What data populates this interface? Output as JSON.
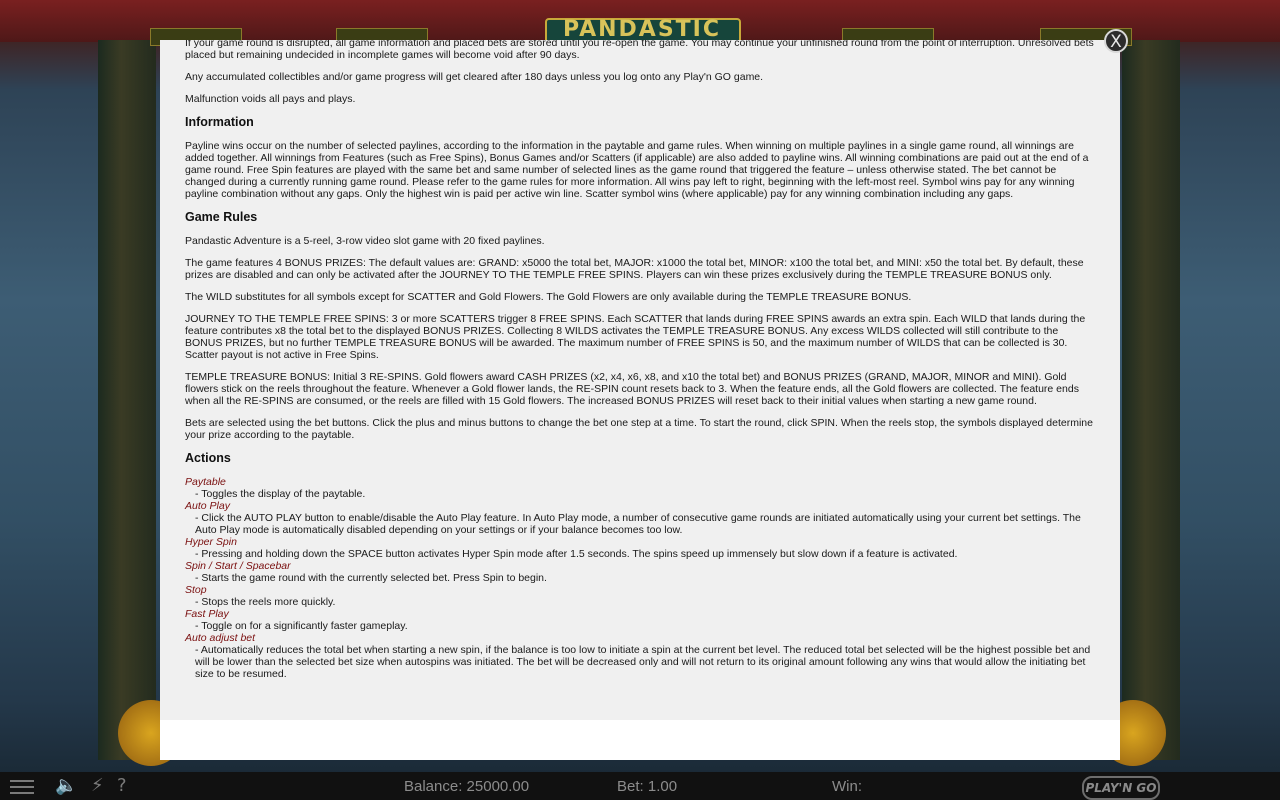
{
  "game": {
    "logo_text": "PANDASTIC"
  },
  "bottom_bar": {
    "balance": "Balance: 25000.00",
    "bet": "Bet: 1.00",
    "win": "Win:",
    "brand": "PLAY'N GO",
    "help_label": "?",
    "turbo_label": "⚡",
    "sound_label": "🔈"
  },
  "modal": {
    "close_label": "X",
    "paragraphs_intro": [
      "If your game round is disrupted, all game information and placed bets are stored until you re-open the game. You may continue your unfinished round from the point of interruption. Unresolved bets placed but remaining undecided in incomplete games will become void after 90 days.",
      "Any accumulated collectibles and/or game progress will get cleared after 180 days unless you log onto any Play'n GO game.",
      "Malfunction voids all pays and plays."
    ],
    "information": {
      "heading": "Information",
      "text": "Payline wins occur on the number of selected paylines, according to the information in the paytable and game rules. When winning on multiple paylines in a single game round, all winnings are added together. All winnings from Features (such as Free Spins), Bonus Games and/or Scatters (if applicable) are also added to payline wins. All winning combinations are paid out at the end of a game round. Free Spin features are played with the same bet and same number of selected lines as the game round that triggered the feature – unless otherwise stated. The bet cannot be changed during a currently running game round. Please refer to the game rules for more information. All wins pay left to right, beginning with the left-most reel. Symbol wins pay for any winning payline combination without any gaps. Only the highest win is paid per active win line. Scatter symbol wins (where applicable) pay for any winning combination including any gaps."
    },
    "game_rules": {
      "heading": "Game Rules",
      "paragraphs": [
        "Pandastic Adventure is a 5-reel, 3-row video slot game with 20 fixed paylines.",
        "The game features 4 BONUS PRIZES: The default values are: GRAND: x5000 the total bet, MAJOR: x1000 the total bet, MINOR: x100 the total bet, and MINI: x50 the total bet. By default, these prizes are disabled and can only be activated after the JOURNEY TO THE TEMPLE FREE SPINS. Players can win these prizes exclusively during the TEMPLE TREASURE BONUS only.",
        "The WILD substitutes for all symbols except for SCATTER and Gold Flowers. The Gold Flowers are only available during the TEMPLE TREASURE BONUS.",
        "JOURNEY TO THE TEMPLE FREE SPINS: 3 or more SCATTERS trigger 8 FREE SPINS. Each SCATTER that lands during FREE SPINS awards an extra spin. Each WILD that lands during the feature contributes x8 the total bet to the displayed BONUS PRIZES. Collecting 8 WILDS activates the TEMPLE TREASURE BONUS. Any excess WILDS collected will still contribute to the BONUS PRIZES, but no further TEMPLE TREASURE BONUS will be awarded. The maximum number of FREE SPINS is 50, and the maximum number of WILDS that can be collected is 30. Scatter payout is not active in Free Spins.",
        "TEMPLE TREASURE BONUS: Initial 3 RE-SPINS. Gold flowers award CASH PRIZES (x2, x4, x6, x8, and x10 the total bet) and BONUS PRIZES (GRAND, MAJOR, MINOR and MINI). Gold flowers stick on the reels throughout the feature. Whenever a Gold flower lands, the RE-SPIN count resets back to 3. When the feature ends, all the Gold flowers are collected. The feature ends when all the RE-SPINS are consumed, or the reels are filled with 15 Gold flowers. The increased BONUS PRIZES will reset back to their initial values when starting a new game round.",
        "Bets are selected using the bet buttons. Click the plus and minus buttons to change the bet one step at a time. To start the round, click SPIN. When the reels stop, the symbols displayed determine your prize according to the paytable."
      ]
    },
    "actions": {
      "heading": "Actions",
      "items": [
        {
          "name": "Paytable",
          "desc": "- Toggles the display of the paytable."
        },
        {
          "name": "Auto Play",
          "desc": "- Click the AUTO PLAY button to enable/disable the Auto Play feature. In Auto Play mode, a number of consecutive game rounds are initiated automatically using your current bet settings. The Auto Play mode is automatically disabled depending on your settings or if your balance becomes too low."
        },
        {
          "name": "Hyper Spin",
          "desc": "- Pressing and holding down the SPACE button activates Hyper Spin mode after 1.5 seconds. The spins speed up immensely but slow down if a feature is activated."
        },
        {
          "name": "Spin / Start / Spacebar",
          "desc": "- Starts the game round with the currently selected bet. Press Spin to begin."
        },
        {
          "name": "Stop",
          "desc": "- Stops the reels more quickly."
        },
        {
          "name": "Fast Play",
          "desc": "- Toggle on for a significantly faster gameplay."
        },
        {
          "name": "Auto adjust bet",
          "desc": "- Automatically reduces the total bet when starting a new spin, if the balance is too low to initiate a spin at the current bet level. The reduced total bet selected will be the highest possible bet and will be lower than the selected bet size when autospins was initiated. The bet will be decreased only and will not return to its original amount following any wins that would allow the initiating bet size to be resumed."
        }
      ]
    }
  }
}
